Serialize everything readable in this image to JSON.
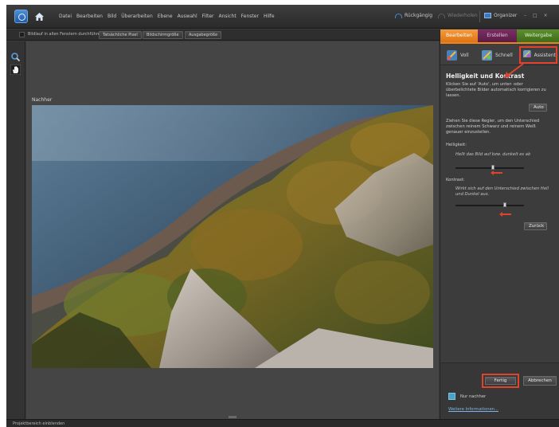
{
  "menubar": {
    "items": [
      "Datei",
      "Bearbeiten",
      "Bild",
      "Überarbeiten",
      "Ebene",
      "Auswahl",
      "Filter",
      "Ansicht",
      "Fenster",
      "Hilfe"
    ],
    "undo_label": "Rückgängig",
    "redo_label": "Wiederholen",
    "organizer_label": "Organizer",
    "window_controls": [
      "–",
      "□",
      "×"
    ]
  },
  "options_bar": {
    "checkbox_label": "Bildlauf in allen Fenstern durchführen",
    "buttons": [
      "Tatsächliche Pixel",
      "Bildschirmgröße",
      "Ausgabegröße"
    ]
  },
  "canvas": {
    "view_label": "Nachher"
  },
  "panel": {
    "mode_tabs": [
      "Bearbeiten",
      "Erstellen",
      "Weitergabe"
    ],
    "sub_tabs": [
      "Voll",
      "Schnell",
      "Assistent"
    ],
    "title": "Helligkeit und Kontrast",
    "auto_help": "Klicken Sie auf 'Auto', um unter- oder überbelichtete Bilder automatisch korrigieren zu lassen.",
    "auto_button": "Auto",
    "slider_help": "Ziehen Sie diese Regler, um den Unterschied zwischen reinem Schwarz und reinem Weiß genauer einzustellen.",
    "brightness_label": "Helligkeit:",
    "brightness_hint": "Hellt das Bild auf bzw. dunkelt es ab",
    "contrast_label": "Kontrast:",
    "contrast_hint": "Wirkt sich auf den Unterschied zwischen Hell und Dunkel aus.",
    "reset_button": "Zurück",
    "done_button": "Fertig",
    "cancel_button": "Abbrechen",
    "after_only_label": "Nur nachher",
    "more_info_link": "Weitere Informationen..."
  },
  "sliders": {
    "brightness_value": 0.55,
    "contrast_value": 0.72
  },
  "statusbar": {
    "text": "Projektbereich einblenden"
  },
  "colors": {
    "accent_orange": "#ea8320",
    "annotation_red": "#e0422c",
    "tab_create": "#6a2456",
    "tab_share": "#4e7e24"
  }
}
